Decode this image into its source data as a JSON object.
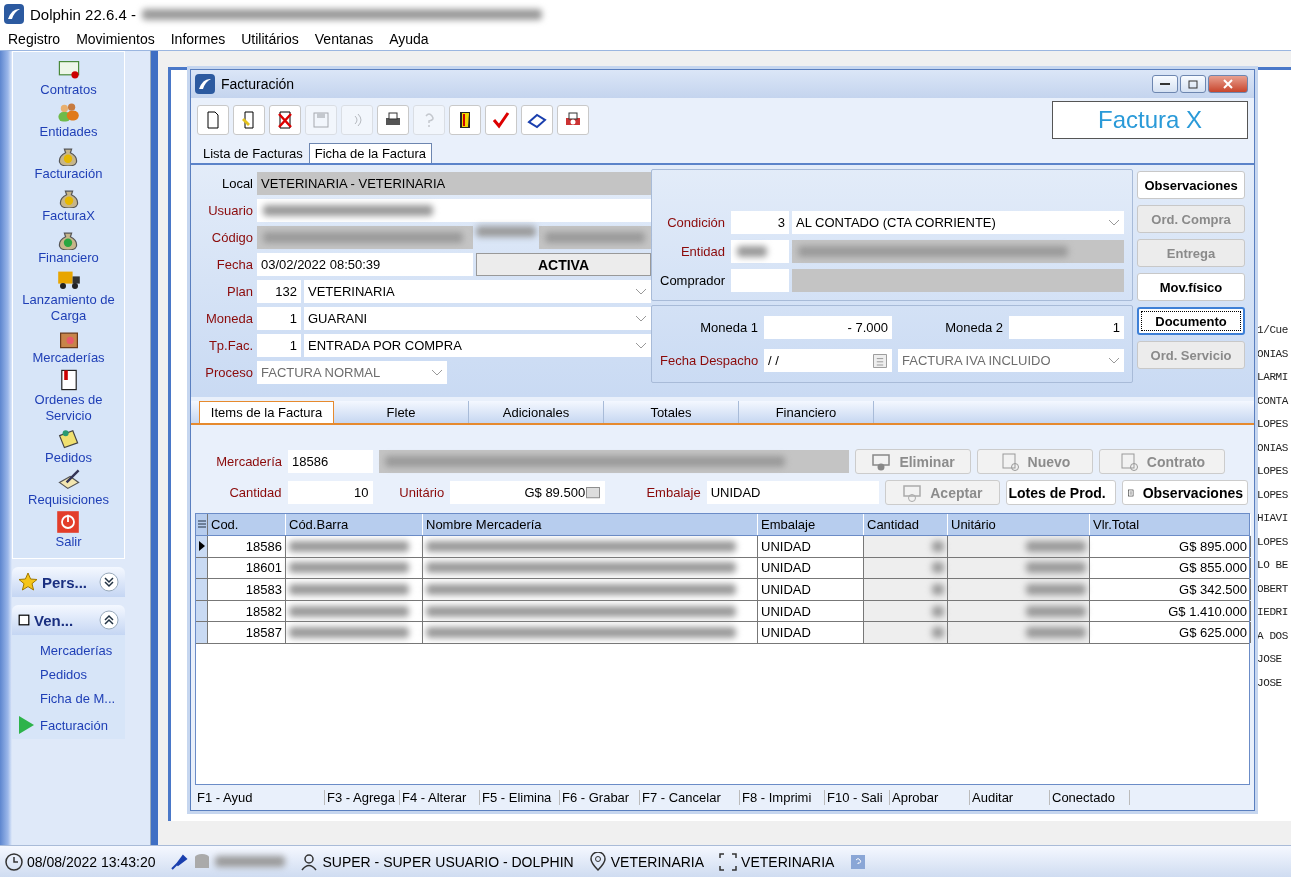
{
  "app": {
    "title": "Dolphin 22.6.4 -"
  },
  "menu": [
    "Registro",
    "Movimientos",
    "Informes",
    "Utilitários",
    "Ventanas",
    "Ayuda"
  ],
  "sidebar": {
    "items": [
      {
        "label": "Contratos"
      },
      {
        "label": "Entidades"
      },
      {
        "label": "Facturación"
      },
      {
        "label": "FacturaX"
      },
      {
        "label": "Financiero"
      },
      {
        "label": "Lanzamiento de Carga"
      },
      {
        "label": "Mercaderías"
      },
      {
        "label": "Ordenes de Servicio"
      },
      {
        "label": "Pedidos"
      },
      {
        "label": "Requisiciones"
      },
      {
        "label": "Salir"
      }
    ],
    "panels": [
      {
        "title": "Pers...",
        "expanded": false
      },
      {
        "title": "Ven...",
        "expanded": true,
        "items": [
          {
            "label": "Mercaderías",
            "selected": false
          },
          {
            "label": "Pedidos",
            "selected": false
          },
          {
            "label": "Ficha de M...",
            "selected": false
          },
          {
            "label": "Facturación",
            "selected": true
          }
        ]
      }
    ]
  },
  "background_list": [
    "1/Cue",
    "ONIAS",
    "LARMI",
    "CONTA",
    "LOPES",
    "ONIAS",
    "LOPES",
    "LOPES",
    "HIAVI",
    "LOPES",
    "LO BE",
    "OBERT",
    "IEDRI",
    "A DOS",
    "JOSE",
    "JOSE"
  ],
  "window": {
    "title": "Facturación",
    "brand": "Factura X",
    "toolbar": [
      {
        "disabled": false
      },
      {
        "disabled": false
      },
      {
        "disabled": false
      },
      {
        "disabled": true
      },
      {
        "disabled": true
      },
      {
        "disabled": false
      },
      {
        "disabled": true
      },
      {
        "disabled": false
      },
      {
        "disabled": false
      },
      {
        "disabled": false
      },
      {
        "disabled": false
      }
    ],
    "tabs": [
      {
        "label": "Lista de Facturas",
        "selected": false
      },
      {
        "label": "Ficha de la Factura",
        "selected": true
      }
    ],
    "form": {
      "local": {
        "label": "Local",
        "value": "VETERINARIA - VETERINARIA"
      },
      "usuario": {
        "label": "Usuario"
      },
      "codigo": {
        "label": "Código"
      },
      "fecha": {
        "label": "Fecha",
        "value": "03/02/2022 08:50:39",
        "status": "ACTIVA"
      },
      "combos": [
        {
          "label": "Plan",
          "code": "132",
          "value": "VETERINARIA"
        },
        {
          "label": "Moneda",
          "code": "1",
          "value": "GUARANI"
        },
        {
          "label": "Tp.Fac.",
          "code": "1",
          "value": "ENTRADA POR COMPRA"
        }
      ],
      "proceso": {
        "label": "Proceso",
        "value": "FACTURA NORMAL"
      },
      "condicion": {
        "label": "Condición",
        "code": "3",
        "value": "AL CONTADO (CTA CORRIENTE)"
      },
      "entidad": {
        "label": "Entidad"
      },
      "comprador": {
        "label": "Comprador"
      },
      "moneda1": {
        "label": "Moneda 1",
        "value": "- 7.000"
      },
      "moneda2": {
        "label": "Moneda 2",
        "value": "1"
      },
      "fecha_despacho": {
        "label": "Fecha Despacho",
        "value": "/ /"
      },
      "tipo_iva": {
        "value": "FACTURA IVA INCLUIDO"
      }
    },
    "side_buttons": [
      {
        "label": "Observaciones",
        "disabled": false,
        "focused": false
      },
      {
        "label": "Ord. Compra",
        "disabled": true,
        "focused": false
      },
      {
        "label": "Entrega",
        "disabled": true,
        "focused": false
      },
      {
        "label": "Mov.físico",
        "disabled": false,
        "focused": false
      },
      {
        "label": "Documento",
        "disabled": false,
        "focused": true
      },
      {
        "label": "Ord. Servicio",
        "disabled": true,
        "focused": false
      }
    ],
    "subtabs": [
      {
        "label": "Items de la Factura",
        "selected": true
      },
      {
        "label": "Flete",
        "selected": false
      },
      {
        "label": "Adicionales",
        "selected": false
      },
      {
        "label": "Totales",
        "selected": false
      },
      {
        "label": "Financiero",
        "selected": false
      }
    ],
    "items": {
      "mercaderia": {
        "label": "Mercadería",
        "code": "18586"
      },
      "cantidad": {
        "label": "Cantidad",
        "value": "10"
      },
      "unitario": {
        "label": "Unitário",
        "value": "G$ 89.500"
      },
      "embalaje": {
        "label": "Embalaje",
        "value": "UNIDAD"
      },
      "buttons": [
        {
          "label": "Eliminar",
          "disabled": true
        },
        {
          "label": "Nuevo",
          "disabled": true
        },
        {
          "label": "Contrato",
          "disabled": true
        },
        {
          "label": "Aceptar",
          "disabled": true
        },
        {
          "label": "Lotes de Prod.",
          "disabled": false
        },
        {
          "label": "Observaciones",
          "disabled": false
        }
      ]
    },
    "table": {
      "columns": [
        "Cod.",
        "Cód.Barra",
        "Nombre Mercadería",
        "Embalaje",
        "Cantidad",
        "Unitário",
        "Vlr.Total"
      ],
      "rows": [
        {
          "cod": "18586",
          "embalaje": "UNIDAD",
          "total": "G$ 895.000",
          "selected": true
        },
        {
          "cod": "18601",
          "embalaje": "UNIDAD",
          "total": "G$ 855.000",
          "selected": false
        },
        {
          "cod": "18583",
          "embalaje": "UNIDAD",
          "total": "G$ 342.500",
          "selected": false
        },
        {
          "cod": "18582",
          "embalaje": "UNIDAD",
          "total": "G$ 1.410.000",
          "selected": false
        },
        {
          "cod": "18587",
          "embalaje": "UNIDAD",
          "total": "G$ 625.000",
          "selected": false
        }
      ]
    },
    "function_bar": [
      "F1 - Ayud",
      "F3 - Agrega",
      "F4 - Alterar",
      "F5 - Elimina",
      "F6 - Grabar",
      "F7 - Cancelar",
      "F8 - Imprimi",
      "F10 - Sali",
      "Aprobar",
      "Auditar",
      "Conectado"
    ]
  },
  "status_bar": {
    "datetime": "08/08/2022 13:43:20",
    "user": "SUPER - SUPER USUARIO - DOLPHIN",
    "location": "VETERINARIA",
    "company": "VETERINARIA"
  }
}
